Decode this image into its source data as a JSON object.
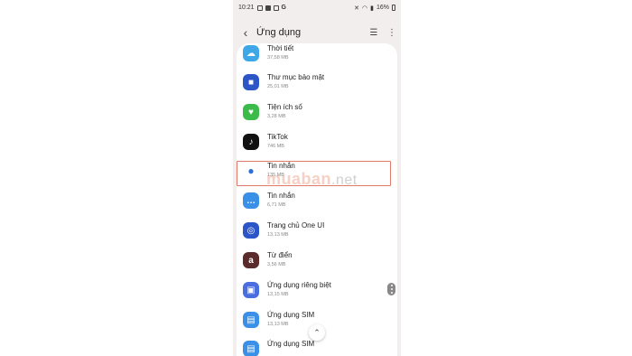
{
  "status_bar": {
    "time": "10:21",
    "carrier_icons": "G",
    "battery": "16%"
  },
  "header": {
    "title": "Ứng dụng"
  },
  "apps": [
    {
      "name": "Thời tiết",
      "size": "37,58 MB",
      "icon": "weather-icon",
      "color": "#3fa7e8",
      "glyph": "☁"
    },
    {
      "name": "Thư mục bảo mật",
      "size": "25,01 MB",
      "icon": "secure-folder-icon",
      "color": "#2c55c8",
      "glyph": "■"
    },
    {
      "name": "Tiện ích số",
      "size": "3,28 MB",
      "icon": "digital-wellbeing-icon",
      "color": "#3dbb4a",
      "glyph": "♥"
    },
    {
      "name": "TikTok",
      "size": "746 MB",
      "icon": "tiktok-icon",
      "color": "#111111",
      "glyph": "♪"
    },
    {
      "name": "Tin nhắn",
      "size": "135 MB",
      "icon": "google-messages-icon",
      "color": "#ffffff",
      "glyph": "●"
    },
    {
      "name": "Tin nhắn",
      "size": "6,71 MB",
      "icon": "samsung-messages-icon",
      "color": "#3a8fe6",
      "glyph": "…"
    },
    {
      "name": "Trang chủ One UI",
      "size": "13,13 MB",
      "icon": "one-ui-home-icon",
      "color": "#2c55c8",
      "glyph": "◎"
    },
    {
      "name": "Từ điển",
      "size": "3,56 MB",
      "icon": "dictionary-icon",
      "color": "#5b2b2b",
      "glyph": "a"
    },
    {
      "name": "Ứng dụng riêng biệt",
      "size": "13,15 MB",
      "icon": "dual-app-icon",
      "color": "#4a6ee0",
      "glyph": "▣"
    },
    {
      "name": "Ứng dụng SIM",
      "size": "13,13 MB",
      "icon": "sim-app-icon",
      "color": "#3a8fe6",
      "glyph": "▤"
    },
    {
      "name": "Ứng dụng SIM",
      "size": "",
      "icon": "sim-app-2-icon",
      "color": "#3a8fe6",
      "glyph": "▤"
    }
  ],
  "watermark": {
    "brand": "muaban",
    "tld": ".net"
  }
}
